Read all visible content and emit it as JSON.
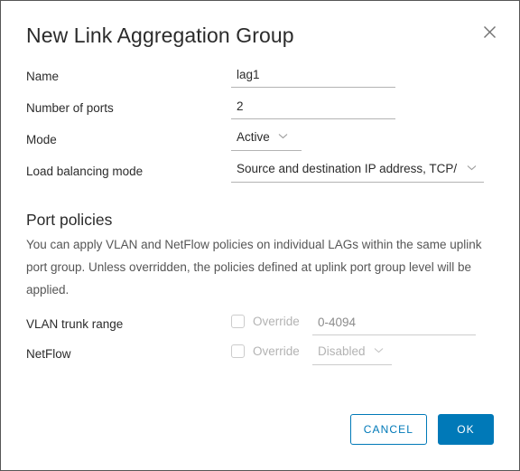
{
  "dialog": {
    "title": "New Link Aggregation Group",
    "close_icon": "close-icon"
  },
  "form": {
    "name": {
      "label": "Name",
      "value": "lag1"
    },
    "number_of_ports": {
      "label": "Number of ports",
      "value": "2"
    },
    "mode": {
      "label": "Mode",
      "value": "Active"
    },
    "load_balancing_mode": {
      "label": "Load balancing mode",
      "value": "Source and destination IP address, TCP/"
    }
  },
  "port_policies": {
    "title": "Port policies",
    "description": "You can apply VLAN and NetFlow policies on individual LAGs within the same uplink port group. Unless overridden, the policies defined at uplink port group level will be applied.",
    "vlan_trunk_range": {
      "label": "VLAN trunk range",
      "override_label": "Override",
      "override_checked": false,
      "value": "0-4094"
    },
    "netflow": {
      "label": "NetFlow",
      "override_label": "Override",
      "override_checked": false,
      "value": "Disabled"
    }
  },
  "footer": {
    "cancel_label": "CANCEL",
    "ok_label": "OK"
  },
  "colors": {
    "accent": "#0079b8",
    "text": "#2b2b2b",
    "muted": "#565656",
    "disabled": "#b3b3b3",
    "border": "#565656"
  }
}
